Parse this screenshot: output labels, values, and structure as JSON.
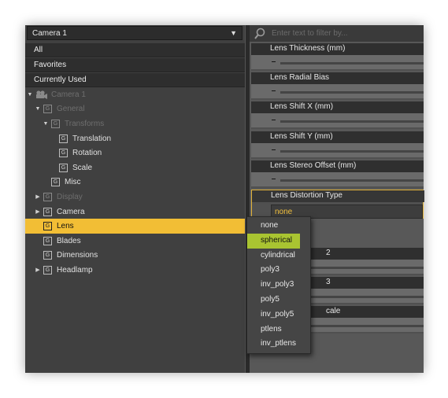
{
  "camera_select": {
    "value": "Camera 1"
  },
  "filter_rows": [
    "All",
    "Favorites",
    "Currently Used"
  ],
  "tree": [
    {
      "label": "Camera 1",
      "level": 0,
      "twist": "▼",
      "icon": "camera-icon",
      "dim": true
    },
    {
      "label": "General",
      "level": 1,
      "twist": "▼",
      "dim": true
    },
    {
      "label": "Transforms",
      "level": 2,
      "twist": "▼",
      "dim": true
    },
    {
      "label": "Translation",
      "level": 3,
      "twist": ""
    },
    {
      "label": "Rotation",
      "level": 3,
      "twist": ""
    },
    {
      "label": "Scale",
      "level": 3,
      "twist": ""
    },
    {
      "label": "Misc",
      "level": 2,
      "twist": ""
    },
    {
      "label": "Display",
      "level": 1,
      "twist": "▶",
      "dim": true
    },
    {
      "label": "Camera",
      "level": 1,
      "twist": "▶"
    },
    {
      "label": "Lens",
      "level": 1,
      "twist": "",
      "selected": true
    },
    {
      "label": "Blades",
      "level": 1,
      "twist": ""
    },
    {
      "label": "Dimensions",
      "level": 1,
      "twist": ""
    },
    {
      "label": "Headlamp",
      "level": 1,
      "twist": "▶"
    }
  ],
  "group_icon_glyph": "G",
  "search": {
    "placeholder": "Enter text to filter by..."
  },
  "properties": [
    {
      "label": "Lens Thickness (mm)"
    },
    {
      "label": "Lens Radial Bias"
    },
    {
      "label": "Lens Shift X (mm)"
    },
    {
      "label": "Lens Shift Y (mm)"
    },
    {
      "label": "Lens Stereo Offset (mm)"
    },
    {
      "label": "Lens Distortion Type",
      "value": "none"
    }
  ],
  "partial_labels": [
    "2",
    "3",
    "cale"
  ],
  "dropdown_options": [
    "none",
    "spherical",
    "cylindrical",
    "poly3",
    "inv_poly3",
    "poly5",
    "inv_poly5",
    "ptlens",
    "inv_ptlens"
  ],
  "dropdown_highlighted": "spherical",
  "colors": {
    "selection": "#f2be35",
    "highlight": "#a9c431",
    "combo_text": "#f3c13e"
  }
}
